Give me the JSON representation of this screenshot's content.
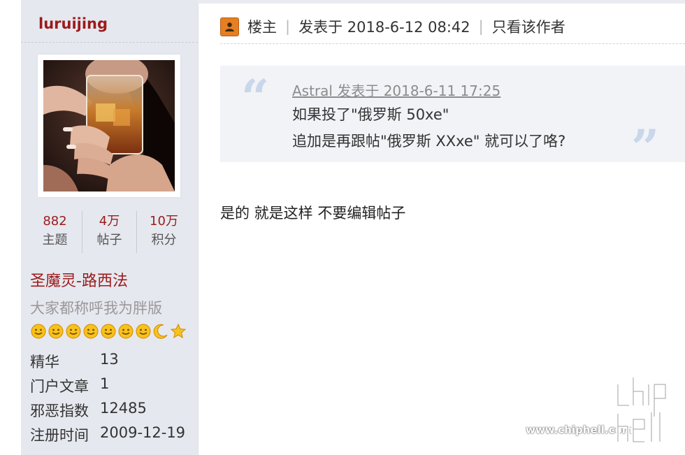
{
  "sidebar": {
    "username": "luruijing",
    "stats": [
      {
        "value": "882",
        "label": "主题"
      },
      {
        "value": "4万",
        "label": "帖子"
      },
      {
        "value": "10万",
        "label": "积分"
      }
    ],
    "rank": "圣魔灵-路西法",
    "signature": "大家都称呼我为胖版",
    "medals": [
      "smiley-face-icon",
      "smiley-face-icon",
      "smiley-face-icon",
      "smiley-face-icon",
      "smiley-face-icon",
      "smiley-face-icon",
      "smiley-face-icon",
      "moon-icon",
      "star-icon"
    ],
    "info": [
      {
        "key": "精华",
        "value": "13"
      },
      {
        "key": "门户文章",
        "value": "1"
      },
      {
        "key": "邪恶指数",
        "value": "12485"
      },
      {
        "key": "注册时间",
        "value": "2009-12-19"
      }
    ]
  },
  "post": {
    "op_label": "楼主",
    "posted_at": "发表于 2018-6-12 08:42",
    "author_only_link": "只看该作者",
    "quote": {
      "meta": "Astral 发表于 2018-6-11 17:25",
      "line1": "如果投了\"俄罗斯 50xe\"",
      "line2": "追加是再跟帖\"俄罗斯 XXxe\" 就可以了咯?"
    },
    "body": "是的 就是这样 不要编辑帖子"
  },
  "watermark": {
    "url": "www.chiphell.com",
    "logo_text": "chiphell"
  },
  "colors": {
    "accent": "#9b1b1b",
    "sidebar_bg": "#e6e8ef",
    "quote_bg": "#f2f3f7",
    "op_icon": "#e67e22"
  }
}
